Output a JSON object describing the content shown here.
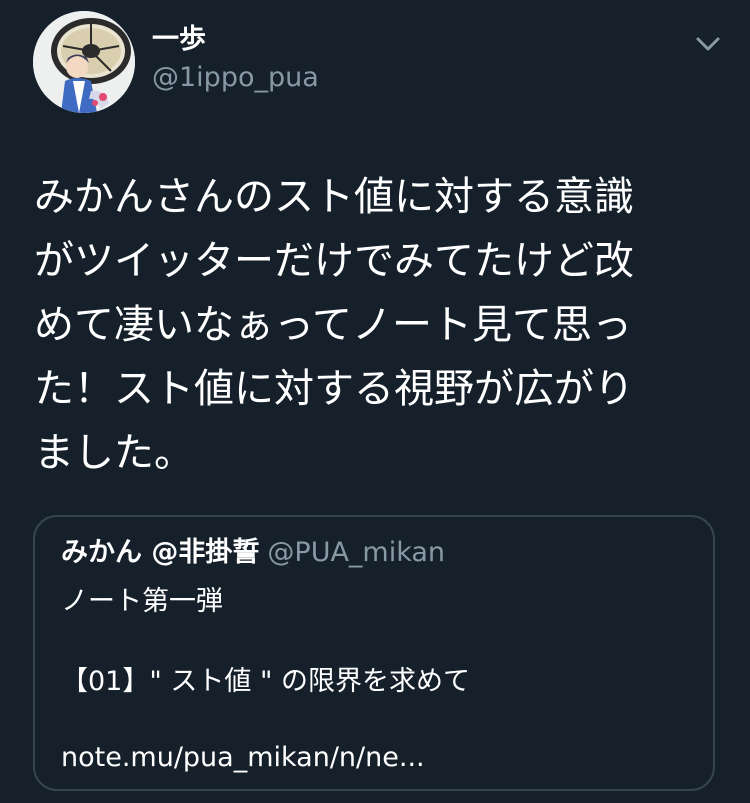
{
  "author": {
    "display_name": "一歩",
    "handle": "@1ippo_pua",
    "avatar_icon": "user-avatar-icon"
  },
  "menu": {
    "icon": "chevron-down-icon"
  },
  "tweet": {
    "lines": [
      "みかんさんのスト値に対する意識",
      "がツイッターだけでみてたけど改",
      "めて凄いなぁってノート見て思っ",
      "た！スト値に対する視野が広がり",
      "ました。"
    ]
  },
  "quoted_tweet": {
    "name": "みかん @非掛誓",
    "handle": "@PUA_mikan",
    "line1": "ノート第一弾",
    "line2": "【01】\" スト値 \" の限界を求めて",
    "line3": "note.mu/pua_mikan/n/ne..."
  },
  "colors": {
    "background": "#15202b",
    "text": "#ffffff",
    "secondary_text": "#8899a6",
    "border": "#38444d"
  }
}
